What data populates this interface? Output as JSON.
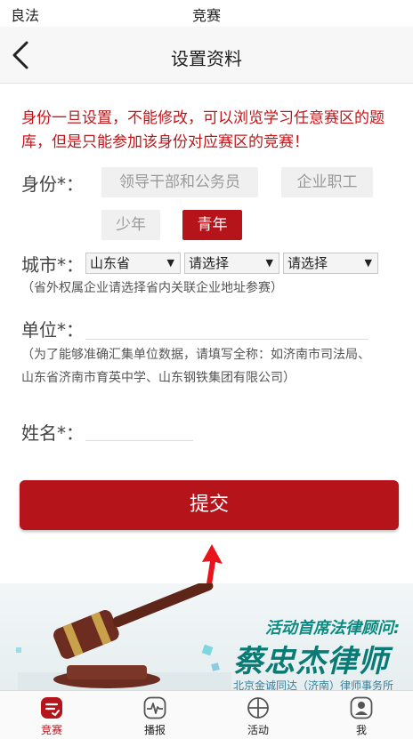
{
  "status_bar": {
    "left_text": "良法",
    "center_text": "竞赛"
  },
  "nav": {
    "title": "设置资料"
  },
  "notice": "身份一旦设置，不能修改，可以浏览学习任意赛区的题库，但是只能参加该身份对应赛区的竞赛！",
  "identity": {
    "label": "身份*：",
    "options": [
      "领导干部和公务员",
      "企业职工",
      "少年",
      "青年"
    ],
    "selected": "青年"
  },
  "city": {
    "label": "城市*：",
    "province": "山东省",
    "city": "请选择",
    "district": "请选择",
    "hint": "（省外权属企业请选择省内关联企业地址参赛）"
  },
  "unit": {
    "label": "单位*：",
    "value": "",
    "hint_line1": "（为了能够准确汇集单位数据，请填写全称：如济南市司法局、",
    "hint_line2": "山东省济南市育英中学、山东钢铁集团有限公司）"
  },
  "name": {
    "label": "姓名*：",
    "value": ""
  },
  "submit_label": "提交",
  "banner": {
    "line1": "活动首席法律顾问:",
    "line2": "蔡忠杰律师",
    "line3": "北京金诚同达（济南）律师事务所"
  },
  "tabs": [
    {
      "label": "竞赛",
      "icon": "contest-icon",
      "active": true
    },
    {
      "label": "播报",
      "icon": "broadcast-icon",
      "active": false
    },
    {
      "label": "活动",
      "icon": "activity-icon",
      "active": false
    },
    {
      "label": "我",
      "icon": "profile-icon",
      "active": false
    }
  ],
  "colors": {
    "accent": "#b5141b",
    "notice_text": "#c0161a",
    "banner_text": "#0a7b74"
  }
}
